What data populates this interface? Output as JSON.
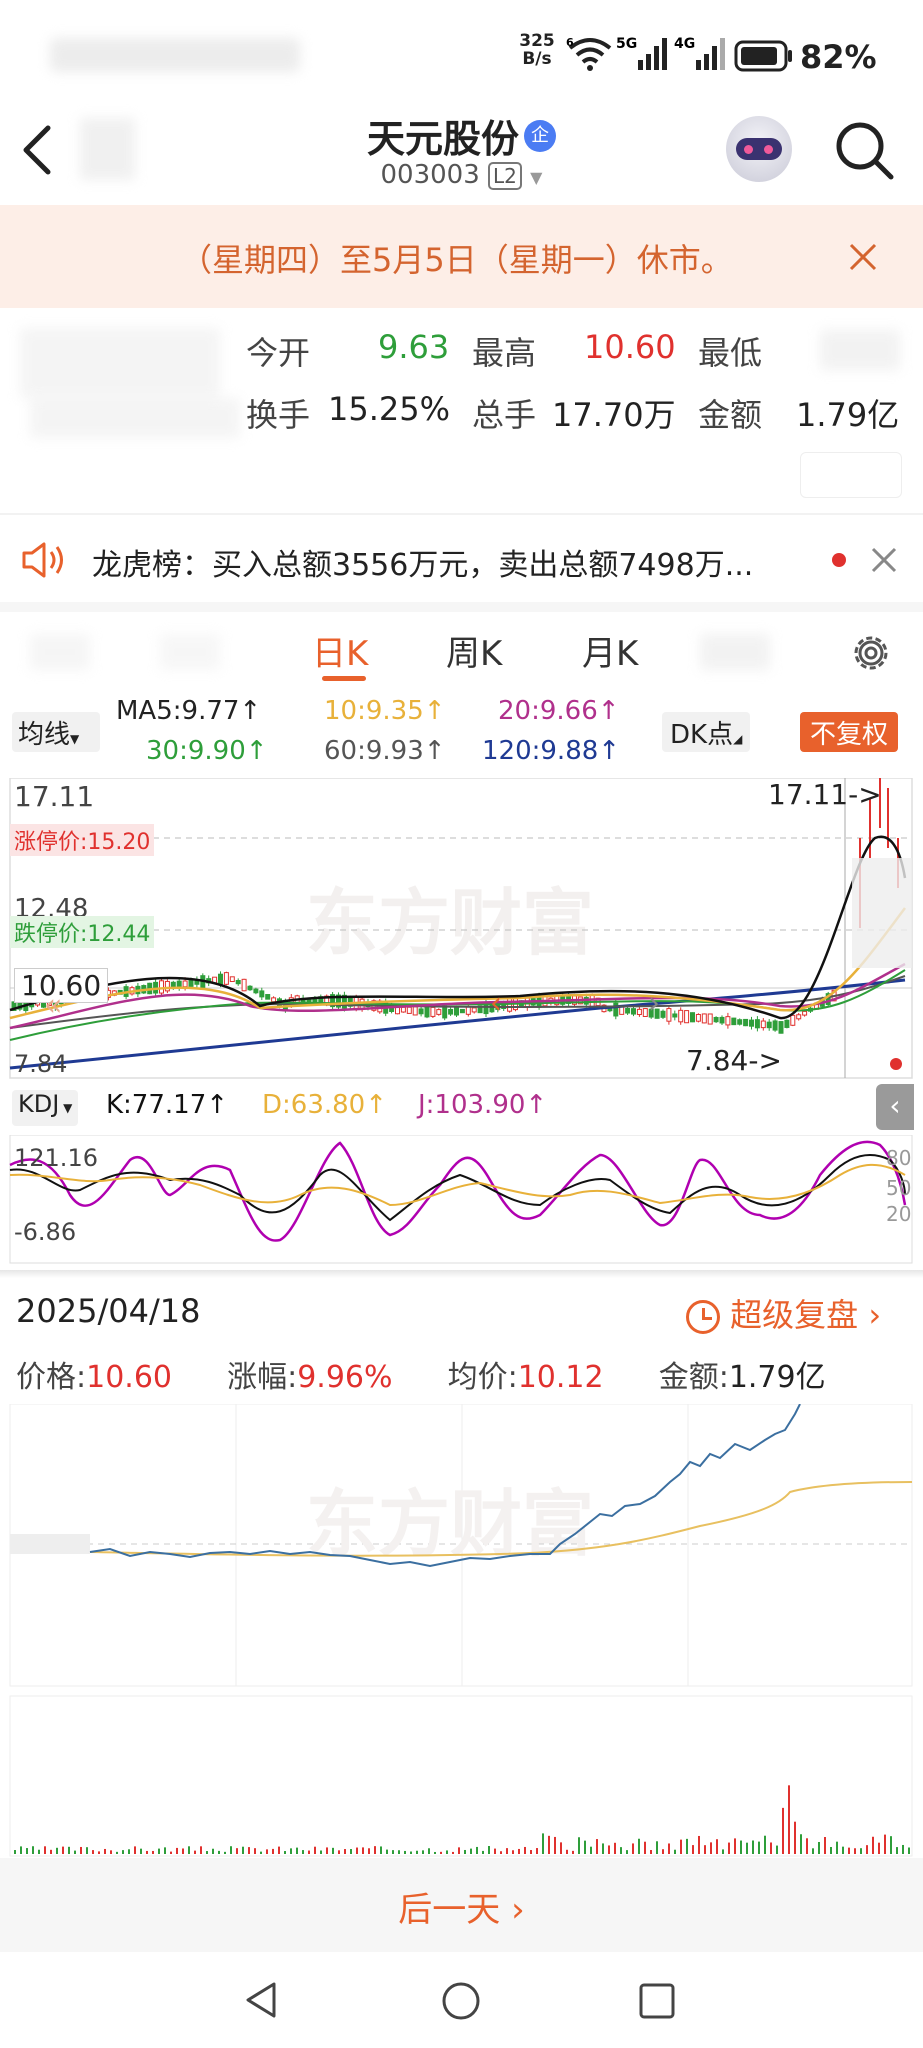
{
  "status_bar": {
    "net_speed_top": "325",
    "net_speed_bottom": "B/s",
    "wifi_tag": "6",
    "sig1_tag": "5G",
    "sig2_tag": "4G",
    "battery": "82%"
  },
  "header": {
    "title": "天元股份",
    "badge": "企",
    "code": "003003",
    "level": "L2"
  },
  "notice": {
    "text": "（星期四）至5月5日（星期一）休市。"
  },
  "quote": {
    "open_label": "今开",
    "open_value": "9.63",
    "high_label": "最高",
    "high_value": "10.60",
    "low_label": "最低",
    "turnover_label": "换手",
    "turnover_value": "15.25%",
    "volume_label": "总手",
    "volume_value": "17.70万",
    "amount_label": "金额",
    "amount_value": "1.79亿"
  },
  "lhb": {
    "text": "龙虎榜：买入总额3556万元，卖出总额7498万..."
  },
  "tabs": {
    "day": "日K",
    "week": "周K",
    "month": "月K"
  },
  "ma": {
    "selector": "均线",
    "ma5": "MA5:9.77↑",
    "ma10": "10:9.35↑",
    "ma20": "20:9.66↑",
    "ma30": "30:9.90↑",
    "ma60": "60:9.93↑",
    "ma120": "120:9.88↑",
    "dk": "DK点",
    "adjust": "不复权"
  },
  "kchart": {
    "top_price": "17.11",
    "limit_up": "涨停价:15.20",
    "mid_price": "12.48",
    "limit_down": "跌停价:12.44",
    "current_price": "10.60",
    "bottom_price": "7.84",
    "high_marker": "17.11->",
    "low_marker": "7.84->",
    "watermark": "东方财富"
  },
  "kdj": {
    "selector": "KDJ",
    "k": "K:77.17↑",
    "d": "D:63.80↑",
    "j": "J:103.90↑",
    "top": "121.16",
    "bottom": "-6.86",
    "r80": "80",
    "r50": "50",
    "r20": "20"
  },
  "intraday": {
    "date": "2025/04/18",
    "replay": "超级复盘",
    "price_label": "价格:",
    "price_value": "10.60",
    "chg_label": "涨幅:",
    "chg_value": "9.96%",
    "avg_label": "均价:",
    "avg_value": "10.12",
    "amt_label": "金额:",
    "amt_value": "1.79亿",
    "watermark": "东方财富"
  },
  "next_day": {
    "label": "后一天"
  },
  "colors": {
    "up": "#e0312e",
    "down": "#2e9e3a",
    "accent": "#e8612c",
    "ma10": "#e8b13a",
    "ma20": "#b0308c",
    "ma120": "#1f3a93"
  }
}
